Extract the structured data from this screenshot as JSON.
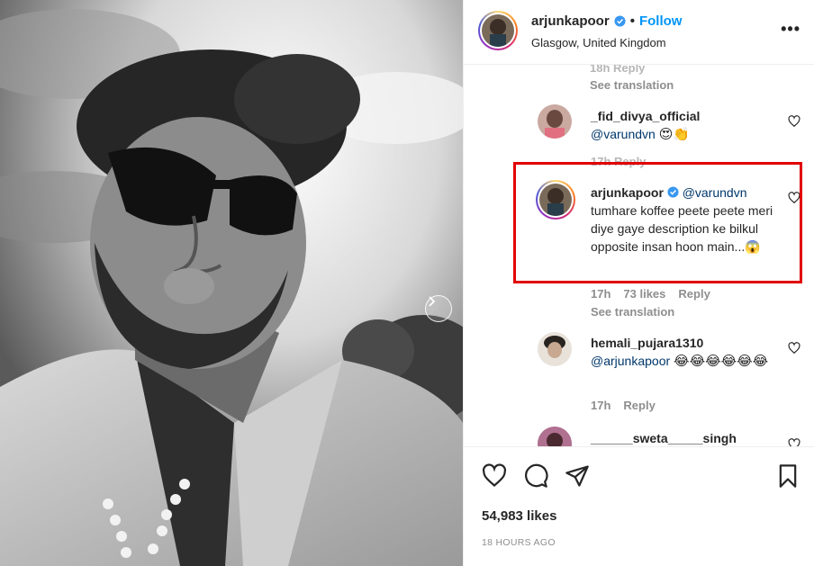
{
  "header": {
    "username": "arjunkapoor",
    "follow_label": "Follow",
    "location": "Glasgow, United Kingdom",
    "separator": "•",
    "more_label": "•••"
  },
  "comments_partial_top": {
    "faint_meta": "18h      Reply",
    "see_translation": "See translation"
  },
  "comments": [
    {
      "username": "_fid_divya_official",
      "mention": "@varundvn",
      "emoji": "😍👏",
      "faint_meta": "17h      Reply"
    },
    {
      "username": "arjunkapoor",
      "mention": "@varundvn",
      "text": "tumhare koffee peete peete meri diye gaye description ke bilkul opposite insan hoon main...😱",
      "time": "17h",
      "likes": "73 likes",
      "reply": "Reply",
      "see_translation": "See translation"
    },
    {
      "username": "hemali_pujara1310",
      "mention": "@arjunkapoor",
      "emoji": "😂😂😂😂😂😂",
      "time": "17h",
      "reply": "Reply"
    },
    {
      "username": "______sweta_____singh"
    }
  ],
  "post": {
    "likes": "54,983 likes",
    "timestamp": "18 HOURS AGO"
  },
  "colors": {
    "accent": "#0095f6",
    "highlight": "#e10000",
    "verified": "#3897f0"
  }
}
